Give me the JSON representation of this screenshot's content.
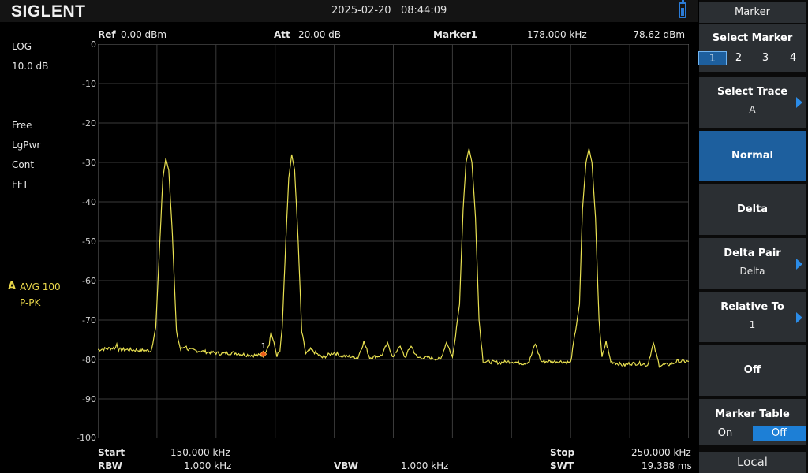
{
  "header": {
    "brand": "SIGLENT",
    "datetime": "2025-02-20   08:44:09",
    "battery_icon": "battery-icon"
  },
  "left_panel": {
    "scale_type": "LOG",
    "scale_div": "10.0 dB",
    "modes": [
      "Free",
      "LgPwr",
      "Cont",
      "FFT"
    ],
    "trace_id": "A",
    "trace_avg": "AVG 100",
    "trace_detector": "P-PK"
  },
  "plot_header": {
    "ref_label": "Ref",
    "ref_value": "0.00 dBm",
    "att_label": "Att",
    "att_value": "20.00 dB",
    "marker_label": "Marker1",
    "marker_freq": "178.000 kHz",
    "marker_level": "-78.62 dBm"
  },
  "y_axis": [
    "0",
    "-10",
    "-20",
    "-30",
    "-40",
    "-50",
    "-60",
    "-70",
    "-80",
    "-90",
    "-100"
  ],
  "footer": {
    "start_label": "Start",
    "start_value": "150.000 kHz",
    "rbw_label": "RBW",
    "rbw_value": "1.000 kHz",
    "vbw_label": "VBW",
    "vbw_value": "1.000 kHz",
    "stop_label": "Stop",
    "stop_value": "250.000 kHz",
    "swt_label": "SWT",
    "swt_value": "19.388 ms"
  },
  "marker_point": {
    "label": "1",
    "freq_khz": 178.0,
    "level_dbm": -78.62
  },
  "chart_data": {
    "type": "line",
    "x_unit": "kHz",
    "y_unit": "dBm",
    "xlim": [
      150,
      250
    ],
    "ylim": [
      -100,
      0
    ],
    "grid": true,
    "series": [
      {
        "color": "#e8e050",
        "points": [
          [
            150,
            -77.5
          ],
          [
            153,
            -77.0
          ],
          [
            153.2,
            -76.0
          ],
          [
            153.5,
            -77.5
          ],
          [
            155,
            -77.5
          ],
          [
            159,
            -77.8
          ],
          [
            159.8,
            -72
          ],
          [
            160.5,
            -50
          ],
          [
            161,
            -34
          ],
          [
            161.5,
            -29.0
          ],
          [
            162,
            -32
          ],
          [
            162.6,
            -48
          ],
          [
            163.3,
            -73
          ],
          [
            164,
            -77.5
          ],
          [
            164.8,
            -76.5
          ],
          [
            165.3,
            -77.5
          ],
          [
            168,
            -78.0
          ],
          [
            171,
            -78.5
          ],
          [
            173,
            -78.3
          ],
          [
            175,
            -78.8
          ],
          [
            178,
            -79.0
          ],
          [
            179,
            -76
          ],
          [
            179.3,
            -73.0
          ],
          [
            179.8,
            -76
          ],
          [
            180.3,
            -79
          ],
          [
            180.8,
            -78
          ],
          [
            181.2,
            -72
          ],
          [
            181.8,
            -50
          ],
          [
            182.3,
            -34
          ],
          [
            182.8,
            -28.0
          ],
          [
            183.3,
            -32
          ],
          [
            183.9,
            -50
          ],
          [
            184.5,
            -73
          ],
          [
            185.2,
            -78.5
          ],
          [
            186,
            -77.5
          ],
          [
            188,
            -79.5
          ],
          [
            190,
            -78.2
          ],
          [
            191,
            -79
          ],
          [
            194,
            -79.5
          ],
          [
            195,
            -75.5
          ],
          [
            196,
            -79.5
          ],
          [
            198,
            -79.0
          ],
          [
            199,
            -76.0
          ],
          [
            200,
            -79.5
          ],
          [
            201,
            -76.5
          ],
          [
            202,
            -79.5
          ],
          [
            203,
            -76.5
          ],
          [
            204,
            -79.5
          ],
          [
            206,
            -79.5
          ],
          [
            208,
            -80.0
          ],
          [
            209,
            -75.5
          ],
          [
            210,
            -79.5
          ],
          [
            211.2,
            -66
          ],
          [
            211.8,
            -42
          ],
          [
            212.3,
            -30
          ],
          [
            212.8,
            -26.5
          ],
          [
            213.3,
            -30
          ],
          [
            213.9,
            -44
          ],
          [
            214.5,
            -70
          ],
          [
            215.2,
            -80.5
          ],
          [
            218,
            -80.8
          ],
          [
            220,
            -80.5
          ],
          [
            222,
            -81.0
          ],
          [
            223,
            -80.5
          ],
          [
            224,
            -76.0
          ],
          [
            225,
            -80.5
          ],
          [
            228,
            -80.5
          ],
          [
            230,
            -80.8
          ],
          [
            231.5,
            -66
          ],
          [
            232,
            -42
          ],
          [
            232.6,
            -30
          ],
          [
            233.1,
            -26.5
          ],
          [
            233.6,
            -30
          ],
          [
            234.2,
            -44
          ],
          [
            234.8,
            -70
          ],
          [
            235.3,
            -79.5
          ],
          [
            236,
            -75.5
          ],
          [
            236.8,
            -80.5
          ],
          [
            239,
            -81.5
          ],
          [
            240,
            -81.0
          ],
          [
            242,
            -81.0
          ],
          [
            243,
            -81.5
          ],
          [
            244,
            -76.0
          ],
          [
            245,
            -81.5
          ],
          [
            247,
            -81.2
          ],
          [
            248,
            -80.5
          ],
          [
            250,
            -80.5
          ]
        ]
      }
    ]
  },
  "menu": {
    "title": "Marker",
    "select_marker_label": "Select Marker",
    "marker_options": [
      "1",
      "2",
      "3",
      "4"
    ],
    "select_trace_label": "Select Trace",
    "select_trace_value": "A",
    "normal_label": "Normal",
    "delta_label": "Delta",
    "delta_pair_label": "Delta Pair",
    "delta_pair_value": "Delta",
    "relative_to_label": "Relative To",
    "relative_to_value": "1",
    "off_label": "Off",
    "marker_table_label": "Marker Table",
    "marker_table_on": "On",
    "marker_table_off": "Off",
    "local_label": "Local"
  }
}
